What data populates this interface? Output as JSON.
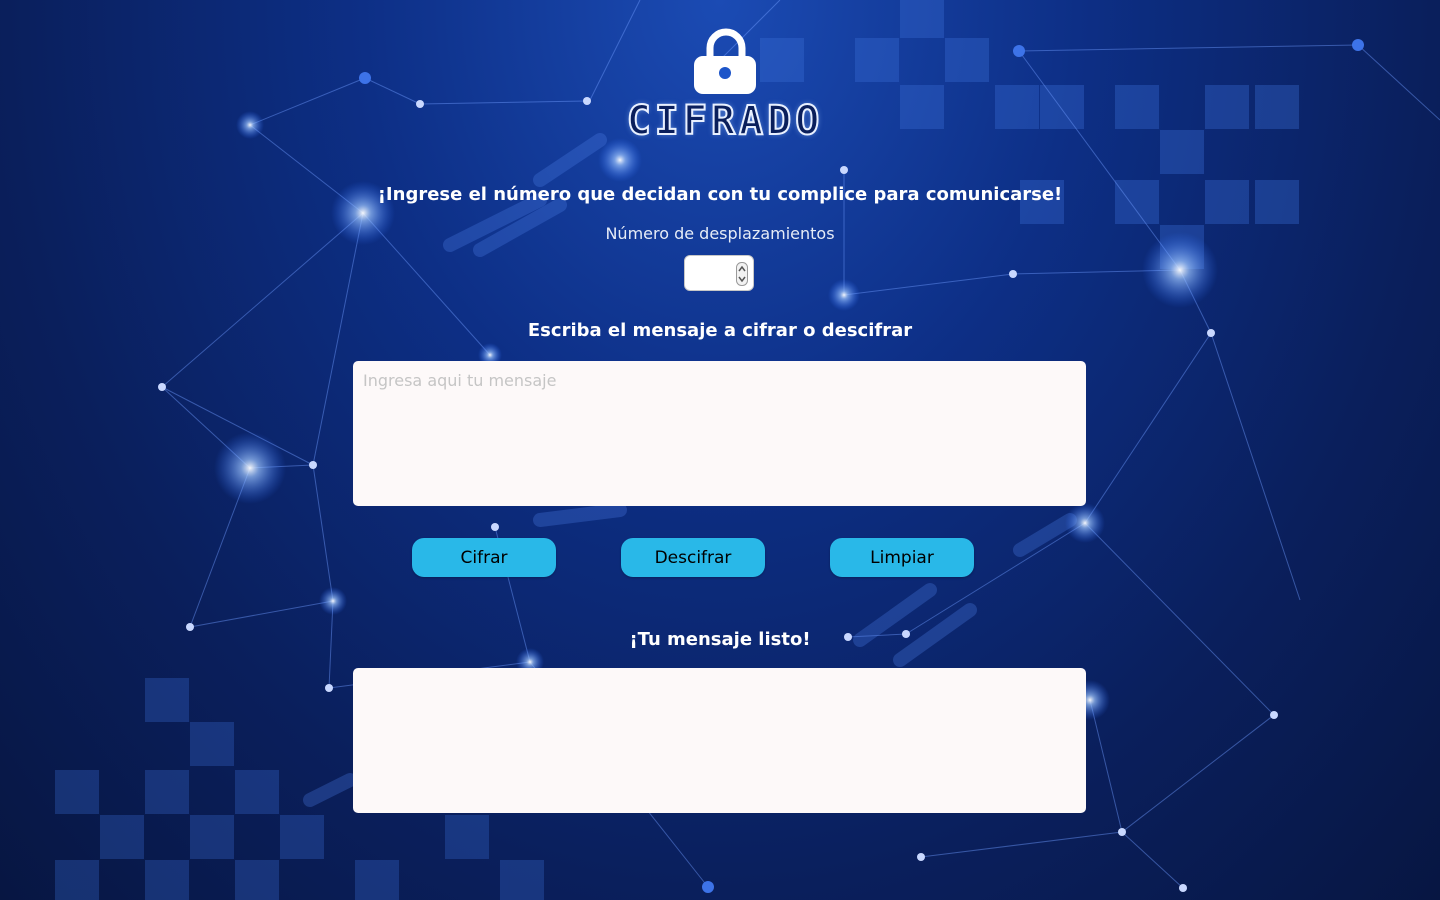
{
  "header": {
    "logo_text": "CIFRADO",
    "logo_icon": "lock-icon"
  },
  "intro": {
    "text": "¡Ingrese el número que decidan con tu complice para comunicarse!"
  },
  "shift": {
    "label": "Número de desplazamientos",
    "value": ""
  },
  "message": {
    "label": "Escriba el mensaje a cifrar o descifrar",
    "placeholder": "Ingresa aqui tu mensaje",
    "value": ""
  },
  "actions": {
    "encrypt_label": "Cifrar",
    "decrypt_label": "Descifrar",
    "clear_label": "Limpiar"
  },
  "result": {
    "label": "¡Tu mensaje listo!",
    "value": ""
  },
  "colors": {
    "background": "#0d2f86",
    "button": "#29b8e8",
    "textarea": "#fdf9f9"
  }
}
